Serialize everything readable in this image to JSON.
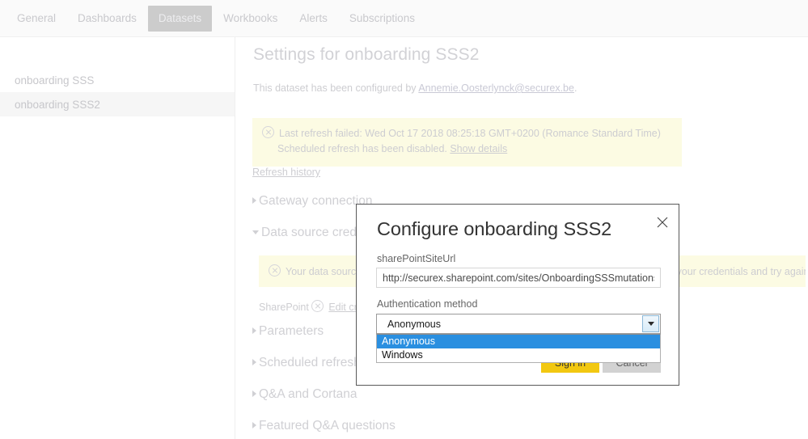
{
  "tabs": [
    {
      "label": "General",
      "selected": false
    },
    {
      "label": "Dashboards",
      "selected": false
    },
    {
      "label": "Datasets",
      "selected": true
    },
    {
      "label": "Workbooks",
      "selected": false
    },
    {
      "label": "Alerts",
      "selected": false
    },
    {
      "label": "Subscriptions",
      "selected": false
    }
  ],
  "sidebar": {
    "items": [
      {
        "label": "onboarding SSS",
        "selected": false
      },
      {
        "label": "onboarding SSS2",
        "selected": true
      }
    ]
  },
  "main": {
    "page_title": "Settings for onboarding SSS2",
    "configured_prefix": "This dataset has been configured by ",
    "configured_link": "Annemie.Oosterlynck@securex.be",
    "configured_suffix": ".",
    "refresh_banner": {
      "line1": "Last refresh failed: Wed Oct 17 2018 08:25:18 GMT+0200 (Romance Standard Time)",
      "line2_text": "Scheduled refresh has been disabled. ",
      "line2_link": "Show details",
      "icon": "circle-x-icon",
      "background": "#fcfbe3"
    },
    "refresh_history_link": "Refresh history",
    "sections": [
      {
        "label": "Gateway connection",
        "expanded": false
      },
      {
        "label": "Data source credentials",
        "expanded": true
      },
      {
        "label": "Parameters",
        "expanded": false
      },
      {
        "label": "Scheduled refresh",
        "expanded": false
      },
      {
        "label": "Q&A and Cortana",
        "expanded": false
      },
      {
        "label": "Featured Q&A questions",
        "expanded": false
      }
    ],
    "credentials": {
      "warning_text": "Your data source can't be refreshed because the credentials are invalid. Please update your credentials and try again.",
      "source_label": "SharePoint",
      "edit_link": "Edit credentials"
    }
  },
  "dialog": {
    "title": "Configure onboarding SSS2",
    "close_icon": "close-icon",
    "url_field": {
      "label": "sharePointSiteUrl",
      "value": "http://securex.sharepoint.com/sites/OnboardingSSSmutations",
      "placeholder": ""
    },
    "auth_field": {
      "label": "Authentication method",
      "selected": "Anonymous",
      "options": [
        {
          "label": "Anonymous",
          "highlighted": true
        },
        {
          "label": "Windows",
          "highlighted": false
        }
      ]
    },
    "buttons": {
      "sign_in": "Sign in",
      "cancel": "Cancel"
    }
  },
  "colors": {
    "accent_yellow": "#f2c811",
    "selection_blue": "#2a8fe0",
    "warning_background": "#fcfbe3",
    "tab_selected_background": "#cccccc"
  }
}
